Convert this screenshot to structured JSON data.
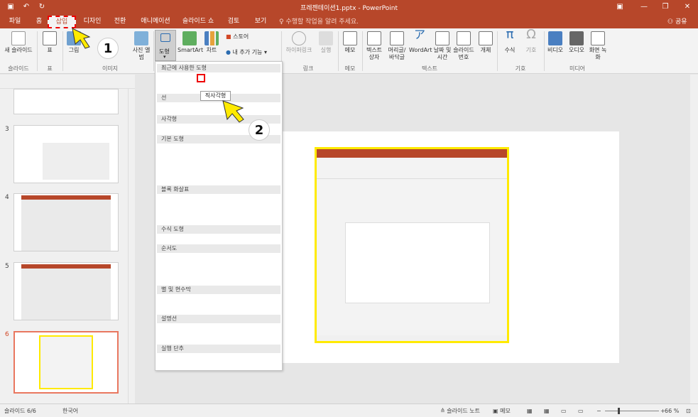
{
  "window": {
    "title": "프레젠테이션1.pptx - PowerPoint",
    "share": "공유"
  },
  "tabs": [
    {
      "label": "파일"
    },
    {
      "label": "홈"
    },
    {
      "label": "삽입"
    },
    {
      "label": "디자인"
    },
    {
      "label": "전환"
    },
    {
      "label": "애니메이션"
    },
    {
      "label": "슬라이드 쇼"
    },
    {
      "label": "검토"
    },
    {
      "label": "보기"
    }
  ],
  "tellme": "수행할 작업을 알려 주세요.",
  "ribbon": {
    "new_slide": "새 슬라이드",
    "table": "표",
    "image": "그림",
    "photo_album": "사진 앨범",
    "shapes": "도형",
    "smartart": "SmartArt",
    "chart": "차트",
    "store": "스토어",
    "my_addins": "내 추가 기능",
    "hyperlink": "하이퍼링크",
    "action": "실행",
    "comment": "메모",
    "textbox": "텍스트 상자",
    "header_footer": "머리글/바닥글",
    "wordart": "WordArt",
    "date_time": "날짜 및 시간",
    "slide_number": "슬라이드 번호",
    "object": "개체",
    "equation": "수식",
    "symbol": "기호",
    "video": "비디오",
    "audio": "오디오",
    "screen_recording": "화면 녹화",
    "groups": {
      "slides": "슬라이드",
      "table": "표",
      "images": "이미지",
      "links": "링크",
      "comments": "메모",
      "text": "텍스트",
      "symbols": "기호",
      "media": "미디어"
    }
  },
  "shapes_menu": {
    "sections": [
      "최근에 사용한 도형",
      "선",
      "사각형",
      "기본 도형",
      "블록 화살표",
      "수식 도형",
      "순서도",
      "별 및 현수막",
      "설명선",
      "실행 단추"
    ],
    "tooltip": "직사각형"
  },
  "callouts": [
    "1",
    "2"
  ],
  "slides": [
    {
      "num": "3"
    },
    {
      "num": "4"
    },
    {
      "num": "5"
    },
    {
      "num": "6"
    }
  ],
  "status": {
    "slide": "슬라이드 6/6",
    "lang": "한국어",
    "notes": "슬라이드 노트",
    "comments": "메모",
    "zoom": "66 %"
  },
  "colors": {
    "accent": "#b7472a",
    "highlight": "#ffea00",
    "selection": "#e9775f"
  }
}
